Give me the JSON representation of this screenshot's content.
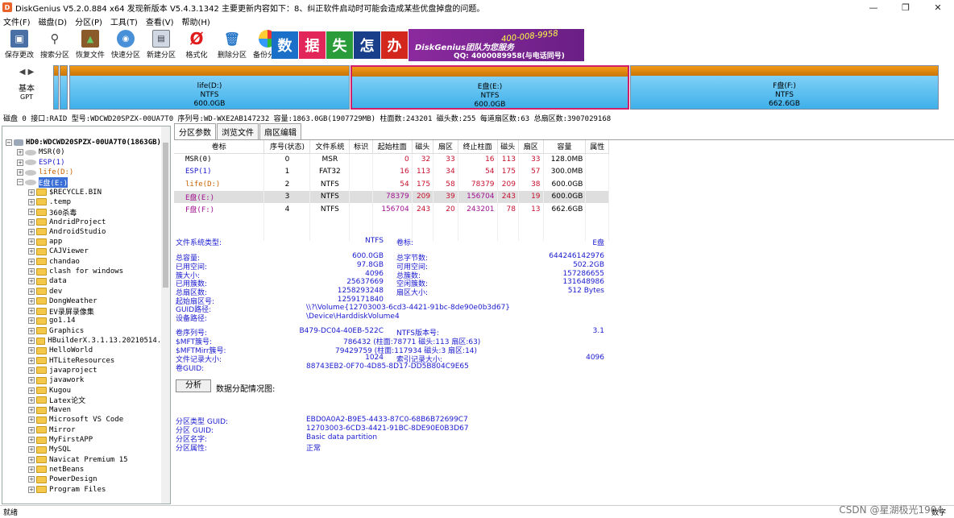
{
  "window": {
    "title": "DiskGenius V5.2.0.884 x64   发现新版本 V5.4.3.1342 主要更新内容如下：8、纠正软件启动时可能会造成某些优盘掉盘的问题。",
    "app_icon": "D"
  },
  "menu": [
    "文件(F)",
    "磁盘(D)",
    "分区(P)",
    "工具(T)",
    "查看(V)",
    "帮助(H)"
  ],
  "toolbar": [
    {
      "label": "保存更改",
      "icon": "save-icon"
    },
    {
      "label": "搜索分区",
      "icon": "search-icon"
    },
    {
      "label": "恢复文件",
      "icon": "recover-icon"
    },
    {
      "label": "快速分区",
      "icon": "quick-partition-icon"
    },
    {
      "label": "新建分区",
      "icon": "new-partition-icon"
    },
    {
      "label": "格式化",
      "icon": "format-icon"
    },
    {
      "label": "删除分区",
      "icon": "delete-icon"
    },
    {
      "label": "备份分区",
      "icon": "backup-icon"
    }
  ],
  "banner": {
    "chars": [
      "数",
      "据",
      "丢",
      "失",
      "怎",
      "么",
      "办"
    ],
    "brand": "DiskGenius团队为您服务",
    "phone": "400-008-9958",
    "qq": "QQ: 4000089958(与电话同号)"
  },
  "diskmap": {
    "basic_label": "基本",
    "gpt_label": "GPT",
    "partitions": [
      {
        "name": "life(D:)",
        "fs": "NTFS",
        "size": "600.0GB"
      },
      {
        "name": "E盘(E:)",
        "fs": "NTFS",
        "size": "600.0GB"
      },
      {
        "name": "F盘(F:)",
        "fs": "NTFS",
        "size": "662.6GB"
      }
    ]
  },
  "disk_info": "磁盘 0 接口:RAID  型号:WDCWD20SPZX-00UA7T0  序列号:WD-WXE2AB147232  容量:1863.0GB(1907729MB)  柱面数:243201  磁头数:255  每道扇区数:63  总扇区数:3907029168",
  "tree": {
    "root": "HD0:WDCWD20SPZX-00UA7T0(1863GB)",
    "partitions": [
      "MSR(0)",
      "ESP(1)",
      "life(D:)",
      "E盘(E:)"
    ],
    "folders": [
      "$RECYCLE.BIN",
      ".temp",
      "360杀毒",
      "AndridProject",
      "AndroidStudio",
      "app",
      "CAJViewer",
      "chandao",
      "clash for windows",
      "data",
      "dev",
      "DongWeather",
      "EV录屏录像集",
      "go1.14",
      "Graphics",
      "HBuilderX.3.1.13.20210514.fu",
      "HelloWorld",
      "HTLiteResources",
      "javaproject",
      "javawork",
      "Kugou",
      "Latex论文",
      "Maven",
      "Microsoft VS Code",
      "Mirror",
      "MyFirstAPP",
      "MySQL",
      "Navicat Premium 15",
      "netBeans",
      "PowerDesign",
      "Program Files"
    ]
  },
  "tabs": [
    "分区参数",
    "浏览文件",
    "扇区编辑"
  ],
  "table": {
    "headers": [
      "卷标",
      "序号(状态)",
      "文件系统",
      "标识",
      "起始柱面",
      "磁头",
      "扇区",
      "终止柱面",
      "磁头",
      "扇区",
      "容量",
      "属性"
    ],
    "rows": [
      [
        "MSR(0)",
        "0",
        "MSR",
        "",
        "0",
        "32",
        "33",
        "16",
        "113",
        "33",
        "128.0MB",
        ""
      ],
      [
        "ESP(1)",
        "1",
        "FAT32",
        "",
        "16",
        "113",
        "34",
        "54",
        "175",
        "57",
        "300.0MB",
        ""
      ],
      [
        "life(D:)",
        "2",
        "NTFS",
        "",
        "54",
        "175",
        "58",
        "78379",
        "209",
        "38",
        "600.0GB",
        ""
      ],
      [
        "E盘(E:)",
        "3",
        "NTFS",
        "",
        "78379",
        "209",
        "39",
        "156704",
        "243",
        "19",
        "600.0GB",
        ""
      ],
      [
        "F盘(F:)",
        "4",
        "NTFS",
        "",
        "156704",
        "243",
        "20",
        "243201",
        "78",
        "13",
        "662.6GB",
        ""
      ]
    ]
  },
  "details": {
    "fs_type_label": "文件系统类型:",
    "fs_type": "NTFS",
    "vol_label_label": "卷标:",
    "vol_label": "E盘",
    "left": [
      [
        "总容量:",
        "600.0GB"
      ],
      [
        "已用空间:",
        "97.8GB"
      ],
      [
        "簇大小:",
        "4096"
      ],
      [
        "已用簇数:",
        "25637669"
      ],
      [
        "总扇区数:",
        "1258293248"
      ],
      [
        "起始扇区号:",
        "1259171840"
      ]
    ],
    "right": [
      [
        "总字节数:",
        "644246142976"
      ],
      [
        "可用空间:",
        "502.2GB"
      ],
      [
        "总簇数:",
        "157286655"
      ],
      [
        "空闲簇数:",
        "131648986"
      ],
      [
        "扇区大小:",
        "512 Bytes"
      ]
    ],
    "guid_path_label": "GUID路径:",
    "guid_path": "\\\\?\\Volume{12703003-6cd3-4421-91bc-8de90e0b3d67}",
    "device_path_label": "设备路径:",
    "device_path": "\\Device\\HarddiskVolume4",
    "serial_label": "卷序列号:",
    "serial": "B479-DC04-40EB-522C",
    "ntfs_ver_label": "NTFS版本号:",
    "ntfs_ver": "3.1",
    "mft_label": "$MFT簇号:",
    "mft": "786432 (柱面:78771 磁头:113 扇区:63)",
    "mftmirr_label": "$MFTMirr簇号:",
    "mftmirr": "79429759 (柱面:117934 磁头:3 扇区:14)",
    "filerec_label": "文件记录大小:",
    "filerec": "1024",
    "indexrec_label": "索引记录大小:",
    "indexrec": "4096",
    "volguid_label": "卷GUID:",
    "volguid": "88743EB2-0F70-4D85-8D17-DD5B804C9E65",
    "analyze_button": "分析",
    "alloc_label": "数据分配情况图:",
    "ptype_guid_label": "分区类型 GUID:",
    "ptype_guid": "EBD0A0A2-B9E5-4433-87C0-68B6B72699C7",
    "part_guid_label": "分区 GUID:",
    "part_guid": "12703003-6CD3-4421-91BC-8DE90E0B3D67",
    "part_name_label": "分区名字:",
    "part_name": "Basic data partition",
    "part_attr_label": "分区属性:",
    "part_attr": "正常"
  },
  "status": {
    "left": "就绪",
    "right": "数字"
  },
  "watermark": "CSDN @星湖极光1904"
}
